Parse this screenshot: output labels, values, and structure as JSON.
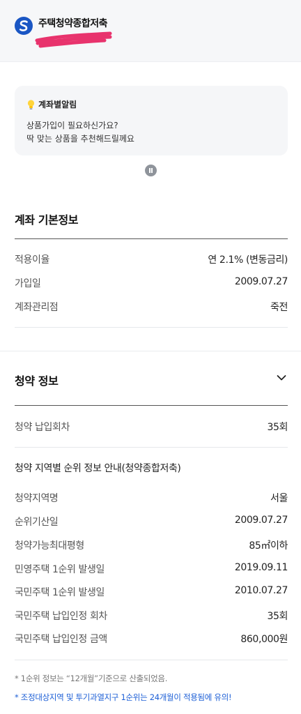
{
  "header": {
    "account_name": "주택청약종합저축",
    "redaction_color": "#e8336d"
  },
  "alert": {
    "title": "계좌별알림",
    "line1": "상품가입이 필요하신가요?",
    "line2": "딱 맞는 상품을 추천해드릴께요"
  },
  "basic_info": {
    "title": "계좌 기본정보",
    "rows": [
      {
        "label": "적용이율",
        "value": "연 2.1% (변동금리)"
      },
      {
        "label": "가입일",
        "value": "2009.07.27"
      },
      {
        "label": "계좌관리점",
        "value": "죽전"
      }
    ]
  },
  "subscription": {
    "title": "청약 정보",
    "payment_count": {
      "label": "청약 납입회차",
      "value": "35회"
    },
    "subtitle": "청약 지역별 순위 정보 안내(청약종합저축)",
    "rows": [
      {
        "label": "청약지역명",
        "value": "서울"
      },
      {
        "label": "순위기산일",
        "value": "2009.07.27"
      },
      {
        "label": "청약가능최대평형",
        "value": "85㎡이하"
      },
      {
        "label": "민영주택 1순위 발생일",
        "value": "2019.09.11"
      },
      {
        "label": "국민주택 1순위 발생일",
        "value": "2010.07.27"
      },
      {
        "label": "국민주택 납입인정 회차",
        "value": "35회"
      },
      {
        "label": "국민주택 납입인정 금액",
        "value": "860,000원"
      }
    ]
  },
  "notes": {
    "note1": "*  1순위 정보는 “12개월”기준으로 산출되었음.",
    "note2": "*  조정대상지역 및 투기과열지구 1순위는 24개월이 적용됨에 유의!"
  },
  "colors": {
    "brand": "#1a56c4",
    "note_highlight": "#1d5fd6"
  }
}
